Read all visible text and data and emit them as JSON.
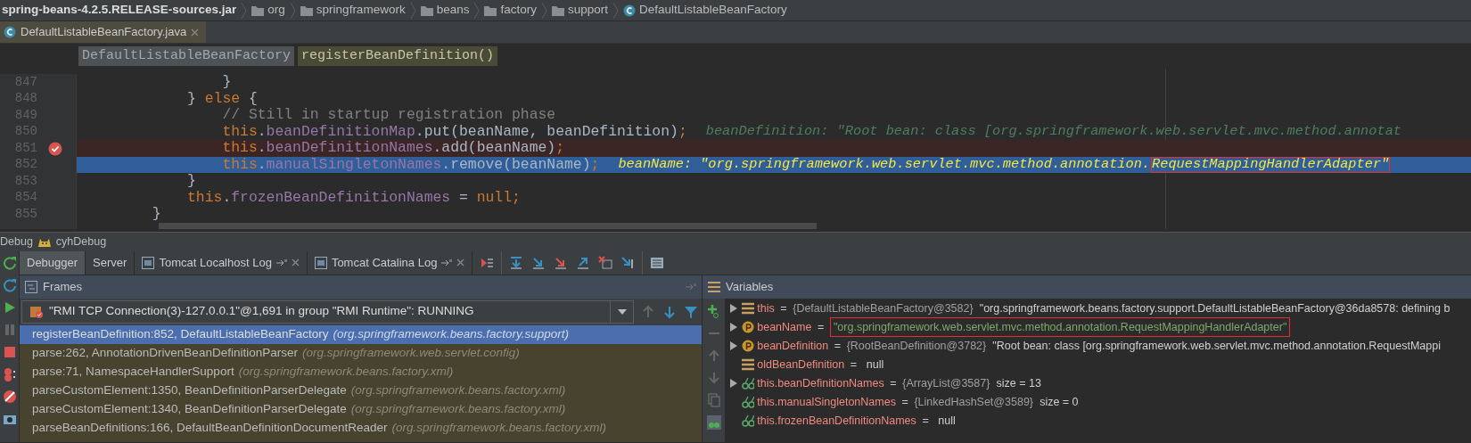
{
  "breadcrumbs": [
    {
      "label": "spring-beans-4.2.5.RELEASE-sources.jar",
      "kind": "jar"
    },
    {
      "label": "org",
      "kind": "folder"
    },
    {
      "label": "springframework",
      "kind": "folder"
    },
    {
      "label": "beans",
      "kind": "folder"
    },
    {
      "label": "factory",
      "kind": "folder"
    },
    {
      "label": "support",
      "kind": "folder"
    },
    {
      "label": "DefaultListableBeanFactory",
      "kind": "class"
    }
  ],
  "file_tabs": [
    {
      "label": "DefaultListableBeanFactory.java",
      "selected": true
    }
  ],
  "editor_crumbs": [
    {
      "label": "DefaultListableBeanFactory",
      "kind": "class"
    },
    {
      "label": "registerBeanDefinition()",
      "kind": "method"
    }
  ],
  "code_lines": [
    {
      "number": "847",
      "breakpoint": false,
      "current": false,
      "tokens": [
        {
          "kind": "plain",
          "text": "                }"
        }
      ]
    },
    {
      "number": "848",
      "breakpoint": false,
      "current": false,
      "tokens": [
        {
          "kind": "plain",
          "text": "            } "
        },
        {
          "kind": "keyword",
          "text": "else"
        },
        {
          "kind": "plain",
          "text": " {"
        }
      ]
    },
    {
      "number": "849",
      "breakpoint": false,
      "current": false,
      "tokens": [
        {
          "kind": "comment",
          "text": "                // Still in startup registration phase"
        }
      ]
    },
    {
      "number": "850",
      "breakpoint": false,
      "current": false,
      "tokens": [
        {
          "kind": "keyword",
          "text": "                this"
        },
        {
          "kind": "plain",
          "text": "."
        },
        {
          "kind": "field",
          "text": "beanDefinitionMap"
        },
        {
          "kind": "plain",
          "text": ".put(beanName, beanDefinition)"
        },
        {
          "kind": "keyword",
          "text": ";"
        }
      ],
      "hint": [
        {
          "text": "beanDefinition: \"Root bean: class [org.springframework.web.servlet.mvc.method.annotat",
          "boxed": false
        }
      ]
    },
    {
      "number": "851",
      "breakpoint": true,
      "current": false,
      "tokens": [
        {
          "kind": "keyword",
          "text": "                this"
        },
        {
          "kind": "plain",
          "text": "."
        },
        {
          "kind": "field",
          "text": "beanDefinitionNames"
        },
        {
          "kind": "plain",
          "text": ".add(beanName)"
        },
        {
          "kind": "keyword",
          "text": ";"
        }
      ]
    },
    {
      "number": "852",
      "breakpoint": false,
      "current": true,
      "tokens": [
        {
          "kind": "keyword",
          "text": "                this"
        },
        {
          "kind": "plain",
          "text": "."
        },
        {
          "kind": "field",
          "text": "manualSingletonNames"
        },
        {
          "kind": "plain",
          "text": ".remove(beanName)"
        },
        {
          "kind": "keyword",
          "text": ";"
        }
      ],
      "hint": [
        {
          "text": "beanName: \"org.springframework.web.servlet.mvc.method.annotation.",
          "boxed": false
        },
        {
          "text": "RequestMappingHandlerAdapter\"",
          "boxed": true
        }
      ]
    },
    {
      "number": "853",
      "breakpoint": false,
      "current": false,
      "tokens": [
        {
          "kind": "plain",
          "text": "            }"
        }
      ]
    },
    {
      "number": "854",
      "breakpoint": false,
      "current": false,
      "tokens": [
        {
          "kind": "keyword",
          "text": "            this"
        },
        {
          "kind": "plain",
          "text": "."
        },
        {
          "kind": "field",
          "text": "frozenBeanDefinitionNames"
        },
        {
          "kind": "plain",
          "text": " = "
        },
        {
          "kind": "keyword",
          "text": "null"
        },
        {
          "kind": "keyword",
          "text": ";"
        }
      ]
    },
    {
      "number": "855",
      "breakpoint": false,
      "current": false,
      "tokens": [
        {
          "kind": "plain",
          "text": "        }"
        }
      ]
    }
  ],
  "debug": {
    "title": "Debug",
    "config": "cyhDebug",
    "tabs": [
      {
        "label": "Debugger",
        "selected": true,
        "closable": false,
        "has_icon": false
      },
      {
        "label": "Server",
        "selected": false,
        "closable": false,
        "has_icon": false
      },
      {
        "label": "Tomcat Localhost Log",
        "selected": false,
        "closable": true,
        "has_icon": true
      },
      {
        "label": "Tomcat Catalina Log",
        "selected": false,
        "closable": true,
        "has_icon": true
      }
    ],
    "frames": {
      "title": "Frames",
      "thread": "\"RMI TCP Connection(3)-127.0.0.1\"@1,691 in group \"RMI Runtime\": RUNNING",
      "items": [
        {
          "method": "registerBeanDefinition:852, DefaultListableBeanFactory",
          "package": "(org.springframework.beans.factory.support)",
          "selected": true
        },
        {
          "method": "parse:262, AnnotationDrivenBeanDefinitionParser",
          "package": "(org.springframework.web.servlet.config)",
          "selected": false
        },
        {
          "method": "parse:71, NamespaceHandlerSupport",
          "package": "(org.springframework.beans.factory.xml)",
          "selected": false
        },
        {
          "method": "parseCustomElement:1350, BeanDefinitionParserDelegate",
          "package": "(org.springframework.beans.factory.xml)",
          "selected": false
        },
        {
          "method": "parseCustomElement:1340, BeanDefinitionParserDelegate",
          "package": "(org.springframework.beans.factory.xml)",
          "selected": false
        },
        {
          "method": "parseBeanDefinitions:166, DefaultBeanDefinitionDocumentReader",
          "package": "(org.springframework.beans.factory.xml)",
          "selected": false
        }
      ]
    },
    "variables": {
      "title": "Variables",
      "items": [
        {
          "kind": "field",
          "expandable": true,
          "name": "this",
          "sep": "=",
          "type": "{DefaultListableBeanFactory@3582}",
          "value": "\"org.springframework.beans.factory.support.DefaultListableBeanFactory@36da8578: defining b",
          "string_value": false,
          "annotated": false
        },
        {
          "kind": "param",
          "expandable": true,
          "name": "beanName",
          "sep": "=",
          "value": "\"org.springframework.web.servlet.mvc.method.annotation.RequestMappingHandlerAdapter\"",
          "string_value": true,
          "annotated": true
        },
        {
          "kind": "param",
          "expandable": true,
          "name": "beanDefinition",
          "sep": "=",
          "type": "{RootBeanDefinition@3782}",
          "value": "\"Root bean: class [org.springframework.web.servlet.mvc.method.annotation.RequestMappi",
          "string_value": false,
          "annotated": false
        },
        {
          "kind": "field",
          "expandable": false,
          "name": "oldBeanDefinition",
          "sep": "=",
          "value": "null",
          "string_value": false,
          "annotated": false
        },
        {
          "kind": "watch",
          "expandable": true,
          "name": "this.beanDefinitionNames",
          "sep": "=",
          "type": "{ArrayList@3587}",
          "value": "size = 13",
          "string_value": false,
          "annotated": false
        },
        {
          "kind": "watch",
          "expandable": false,
          "name": "this.manualSingletonNames",
          "sep": "=",
          "type": "{LinkedHashSet@3589}",
          "value": "size = 0",
          "string_value": false,
          "annotated": false
        },
        {
          "kind": "watch",
          "expandable": false,
          "name": "this.frozenBeanDefinitionNames",
          "sep": "=",
          "value": "null",
          "string_value": false,
          "annotated": false
        }
      ]
    }
  }
}
